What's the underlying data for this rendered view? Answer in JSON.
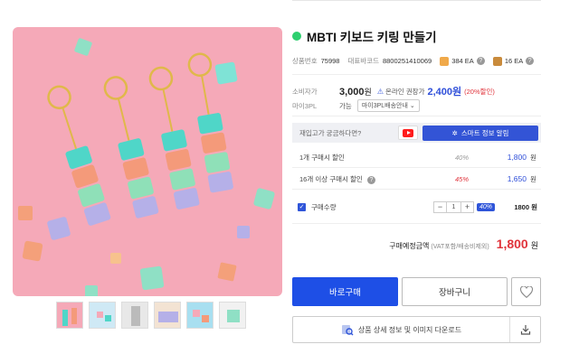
{
  "product": {
    "title": "MBTI 키보드 키링 만들기"
  },
  "meta": {
    "code_label": "상품번호",
    "code_value": "75998",
    "barcode_label": "대표바코드",
    "barcode_value": "8800251410069",
    "stock1": "384 EA",
    "stock2": "16 EA"
  },
  "pricing": {
    "consumer_label": "소비자가",
    "consumer_price": "3,000",
    "won": "원",
    "online_label": "온라인 권장가",
    "online_price": "2,400원",
    "online_discount": "(20%할인)",
    "pl_label": "마이3PL",
    "pl_value": "가능",
    "pl_select": "마이3PL배송안내 ⌄"
  },
  "curious": {
    "text": "재입고가 궁금하다면?",
    "smart_button": "스마트 정보 알림"
  },
  "discounts": [
    {
      "name": "1개 구매시 할인",
      "pct": "40%",
      "amount": "1,800",
      "unit": "원"
    },
    {
      "name": "16개 이상 구매시 할인",
      "pct": "45%",
      "amount": "1,650",
      "unit": "원"
    }
  ],
  "quantity": {
    "label": "구매수량",
    "minus": "−",
    "value": "1",
    "plus": "+",
    "pct": "40%",
    "total": "1800 원"
  },
  "expected": {
    "label": "구매예정금액",
    "sub": "(VAT포함/배송비제외)",
    "price": "1,800",
    "unit": "원"
  },
  "actions": {
    "buy": "바로구매",
    "cart": "장바구니",
    "download": "상품 상세 정보 및 이미지 다운로드"
  },
  "colors": {
    "accent": "#1e4fe6",
    "price_red": "#e0333b",
    "status_green": "#2ecf6f"
  }
}
